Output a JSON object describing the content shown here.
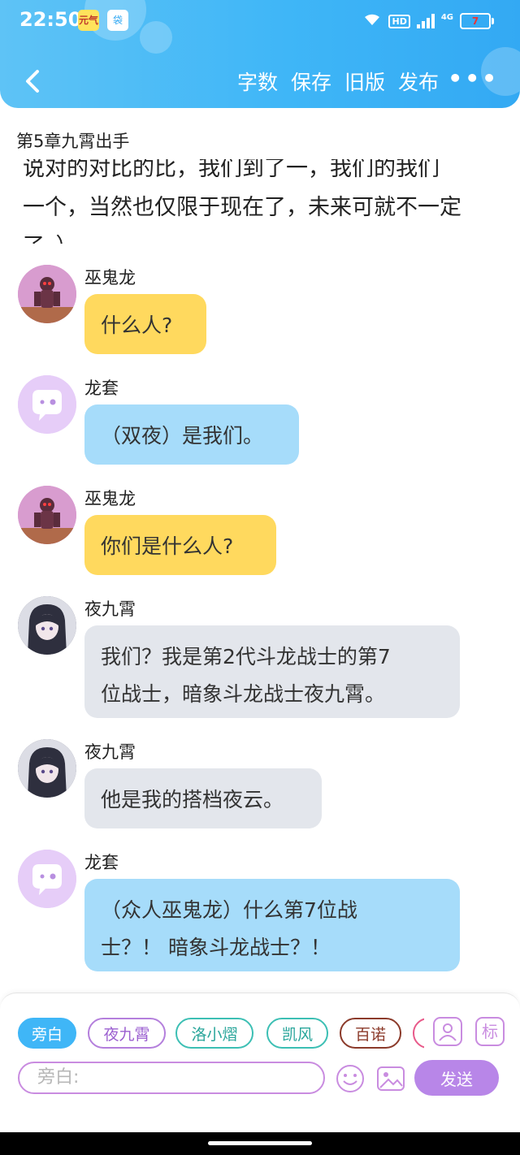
{
  "status": {
    "time": "22:50",
    "app_icon_1": "元气",
    "app_icon_2": "袋",
    "hd": "HD",
    "network": "4G",
    "battery": "7"
  },
  "toolbar": {
    "back_icon": "chevron-left-icon",
    "word_count": "字数",
    "save": "保存",
    "old_version": "旧版",
    "publish": "发布",
    "more": "•••"
  },
  "chapter": {
    "title": "第5章九霄出手",
    "partial_line": "说对的对比的比，我们到了一，我们的我们",
    "text_line_1": "一个，当然也仅限于现在了，未来可就不一定",
    "text_line_2": "了。）"
  },
  "messages": [
    {
      "sender": "巫鬼龙",
      "text": "什么人?",
      "avatar": "dragon-avatar",
      "color": "#ffd95e"
    },
    {
      "sender": "龙套",
      "text": "（双夜）是我们。",
      "avatar": "chat-bubble-avatar",
      "color": "#a6dcfa"
    },
    {
      "sender": "巫鬼龙",
      "text": "你们是什么人?",
      "avatar": "dragon-avatar",
      "color": "#ffd95e"
    },
    {
      "sender": "夜九霄",
      "line1": "我们？我是第2代斗龙战士的第7",
      "line2": "位战士，暗象斗龙战士夜九霄。",
      "avatar": "girl-avatar",
      "color": "#e3e6ec"
    },
    {
      "sender": "夜九霄",
      "text": "他是我的搭档夜云。",
      "avatar": "girl-avatar",
      "color": "#e3e6ec"
    },
    {
      "sender": "龙套",
      "line1": "（众人巫鬼龙）什么第7位战",
      "line2": "士？！ 暗象斗龙战士？！",
      "avatar": "chat-bubble-avatar",
      "color": "#a6dcfa"
    }
  ],
  "composer": {
    "chips": [
      {
        "label": "旁白",
        "color": "#3fb6f7",
        "active": true
      },
      {
        "label": "夜九霄",
        "color": "#b47fdc",
        "active": false
      },
      {
        "label": "洛小熠",
        "color": "#3cbfb4",
        "active": false
      },
      {
        "label": "凯风",
        "color": "#3cbfb4",
        "active": false
      },
      {
        "label": "百诺",
        "color": "#a0522d",
        "active": false
      },
      {
        "label": "",
        "color": "#e85a8a",
        "active": false
      }
    ],
    "role_icon": "person-add-icon",
    "tag_label": "标",
    "placeholder": "旁白:",
    "emoji_icon": "smiley-icon",
    "image_icon": "image-icon",
    "send": "发送"
  }
}
